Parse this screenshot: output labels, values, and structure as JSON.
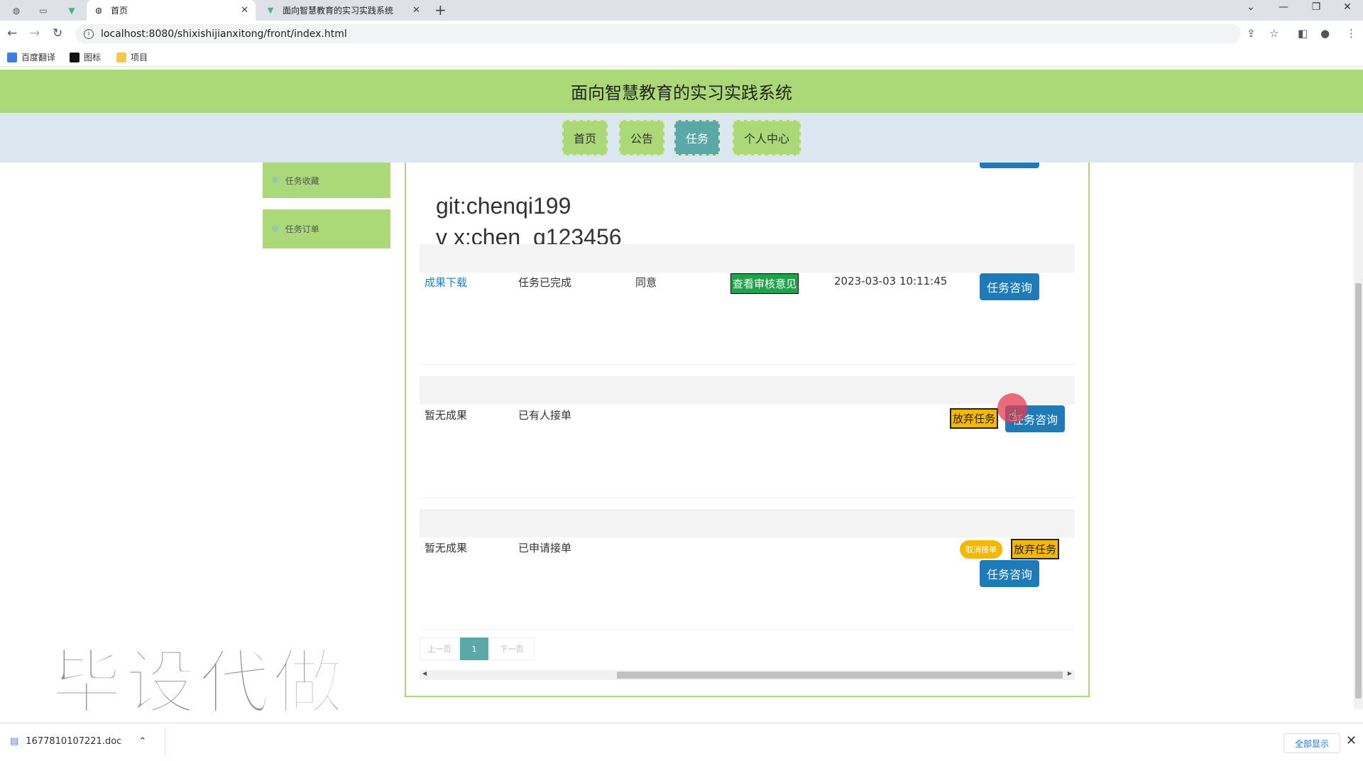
{
  "browser": {
    "tabs": [
      {
        "title": "首页",
        "active": true
      },
      {
        "title": "面向智慧教育的实习实践系统",
        "active": false
      }
    ],
    "url": "localhost:8080/shixishijianxitong/front/index.html",
    "bookmarks": [
      "百度翻译",
      "图标",
      "项目"
    ]
  },
  "site": {
    "title": "面向智慧教育的实习实践系统",
    "nav": [
      "首页",
      "公告",
      "任务",
      "个人中心"
    ],
    "active_nav": "任务"
  },
  "sidebar": {
    "items": [
      "任务收藏",
      "任务订单"
    ]
  },
  "overlay_text": {
    "line1": "git:chenqi199",
    "line2": "v x:chen_q123456"
  },
  "orders": [
    {
      "result": "成果下载",
      "status": "任务已完成",
      "review": "同意",
      "view_review": "查看审核意见",
      "time": "2023-03-03 10:11:45",
      "consult": "任务咨询"
    },
    {
      "result": "暂无成果",
      "status": "已有人接单",
      "abandon": "放弃任务",
      "consult": "任务咨询"
    },
    {
      "result": "暂无成果",
      "status": "已申请接单",
      "cancel": "取消接单",
      "abandon": "放弃任务",
      "consult": "任务咨询"
    }
  ],
  "pager": {
    "prev": "上一页",
    "page": "1",
    "next": "下一页"
  },
  "watermark": "毕设代做",
  "download": {
    "filename": "1677810107221.doc",
    "show_all": "全部显示"
  }
}
